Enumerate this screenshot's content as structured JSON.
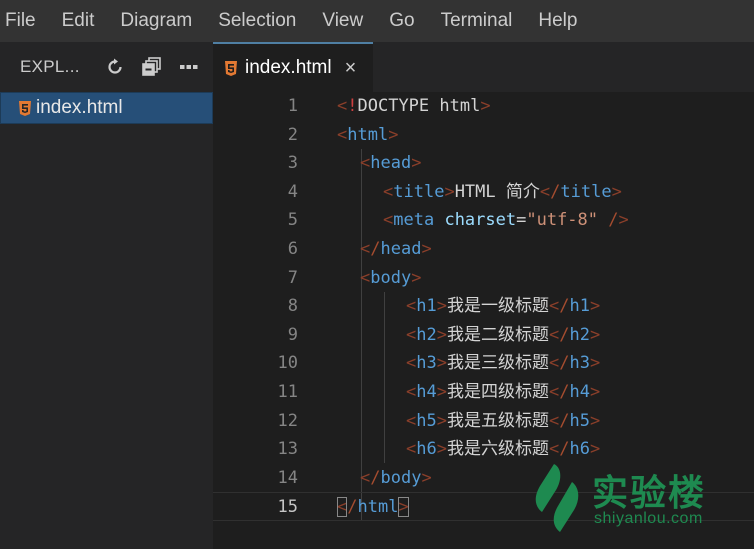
{
  "menubar": {
    "items": [
      "File",
      "Edit",
      "Diagram",
      "Selection",
      "View",
      "Go",
      "Terminal",
      "Help"
    ]
  },
  "sidebar": {
    "title": "EXPL...",
    "actions": [
      {
        "name": "refresh-icon"
      },
      {
        "name": "collapse-all-icon"
      },
      {
        "name": "more-actions-icon"
      }
    ],
    "files": [
      {
        "name": "index.html",
        "icon": "html5-icon",
        "selected": true
      }
    ]
  },
  "tabs": [
    {
      "label": "index.html",
      "icon": "html5-icon",
      "active": true,
      "close": "×"
    }
  ],
  "editor": {
    "active_line": 15,
    "lines": [
      {
        "n": "1",
        "tokens": [
          [
            "br",
            "<"
          ],
          [
            "ex",
            "!"
          ],
          [
            "tx",
            "DOCTYPE html"
          ],
          [
            "br",
            ">"
          ]
        ],
        "indent": 0
      },
      {
        "n": "2",
        "tokens": [
          [
            "br",
            "<"
          ],
          [
            "tg",
            "html"
          ],
          [
            "br",
            ">"
          ]
        ],
        "indent": 0
      },
      {
        "n": "3",
        "tokens": [
          [
            "br",
            "<"
          ],
          [
            "tg",
            "head"
          ],
          [
            "br",
            ">"
          ]
        ],
        "indent": 1
      },
      {
        "n": "4",
        "tokens": [
          [
            "br",
            "<"
          ],
          [
            "tg",
            "title"
          ],
          [
            "br",
            ">"
          ],
          [
            "tx",
            "HTML 简介"
          ],
          [
            "br",
            "</"
          ],
          [
            "tg",
            "title"
          ],
          [
            "br",
            ">"
          ]
        ],
        "indent": 2
      },
      {
        "n": "5",
        "tokens": [
          [
            "br",
            "<"
          ],
          [
            "tg",
            "meta"
          ],
          [
            "tx",
            " "
          ],
          [
            "at",
            "charset"
          ],
          [
            "tx",
            "="
          ],
          [
            "str",
            "\"utf-8\""
          ],
          [
            "tx",
            " "
          ],
          [
            "br",
            "/>"
          ]
        ],
        "indent": 2
      },
      {
        "n": "6",
        "tokens": [
          [
            "br",
            "</"
          ],
          [
            "tg",
            "head"
          ],
          [
            "br",
            ">"
          ]
        ],
        "indent": 1
      },
      {
        "n": "7",
        "tokens": [
          [
            "br",
            "<"
          ],
          [
            "tg",
            "body"
          ],
          [
            "br",
            ">"
          ]
        ],
        "indent": 1
      },
      {
        "n": "8",
        "tokens": [
          [
            "br",
            "<"
          ],
          [
            "tg",
            "h1"
          ],
          [
            "br",
            ">"
          ],
          [
            "tx",
            "我是一级标题"
          ],
          [
            "br",
            "</"
          ],
          [
            "tg",
            "h1"
          ],
          [
            "br",
            ">"
          ]
        ],
        "indent": 3
      },
      {
        "n": "9",
        "tokens": [
          [
            "br",
            "<"
          ],
          [
            "tg",
            "h2"
          ],
          [
            "br",
            ">"
          ],
          [
            "tx",
            "我是二级标题"
          ],
          [
            "br",
            "</"
          ],
          [
            "tg",
            "h2"
          ],
          [
            "br",
            ">"
          ]
        ],
        "indent": 3
      },
      {
        "n": "10",
        "tokens": [
          [
            "br",
            "<"
          ],
          [
            "tg",
            "h3"
          ],
          [
            "br",
            ">"
          ],
          [
            "tx",
            "我是三级标题"
          ],
          [
            "br",
            "</"
          ],
          [
            "tg",
            "h3"
          ],
          [
            "br",
            ">"
          ]
        ],
        "indent": 3
      },
      {
        "n": "11",
        "tokens": [
          [
            "br",
            "<"
          ],
          [
            "tg",
            "h4"
          ],
          [
            "br",
            ">"
          ],
          [
            "tx",
            "我是四级标题"
          ],
          [
            "br",
            "</"
          ],
          [
            "tg",
            "h4"
          ],
          [
            "br",
            ">"
          ]
        ],
        "indent": 3
      },
      {
        "n": "12",
        "tokens": [
          [
            "br",
            "<"
          ],
          [
            "tg",
            "h5"
          ],
          [
            "br",
            ">"
          ],
          [
            "tx",
            "我是五级标题"
          ],
          [
            "br",
            "</"
          ],
          [
            "tg",
            "h5"
          ],
          [
            "br",
            ">"
          ]
        ],
        "indent": 3
      },
      {
        "n": "13",
        "tokens": [
          [
            "br",
            "<"
          ],
          [
            "tg",
            "h6"
          ],
          [
            "br",
            ">"
          ],
          [
            "tx",
            "我是六级标题"
          ],
          [
            "br",
            "</"
          ],
          [
            "tg",
            "h6"
          ],
          [
            "br",
            ">"
          ]
        ],
        "indent": 3
      },
      {
        "n": "14",
        "tokens": [
          [
            "br",
            "</"
          ],
          [
            "tg",
            "body"
          ],
          [
            "br",
            ">"
          ]
        ],
        "indent": 1
      },
      {
        "n": "15",
        "tokens": [
          [
            "br",
            "</"
          ],
          [
            "tg",
            "html"
          ],
          [
            "br",
            ">"
          ]
        ],
        "indent": 0
      }
    ]
  },
  "watermark": {
    "brand": "实验楼",
    "domain": "shiyanlou.com",
    "color": "#1e8a50"
  },
  "colors": {
    "tag": "#569cd6",
    "attribute": "#9cdcfe",
    "string": "#ce9178",
    "bracket": "#a44c2f",
    "selection": "#264f78"
  }
}
